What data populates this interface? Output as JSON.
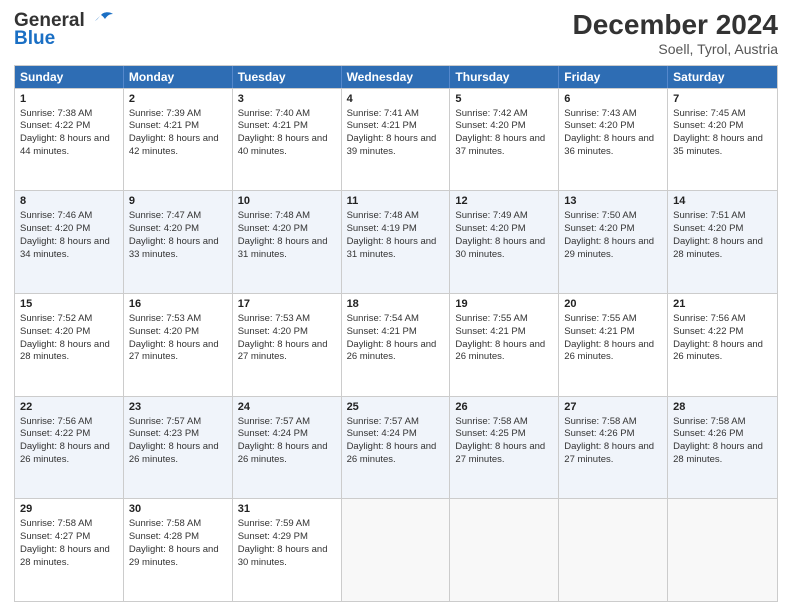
{
  "logo": {
    "line1": "General",
    "line2": "Blue"
  },
  "title": "December 2024",
  "subtitle": "Soell, Tyrol, Austria",
  "days": [
    "Sunday",
    "Monday",
    "Tuesday",
    "Wednesday",
    "Thursday",
    "Friday",
    "Saturday"
  ],
  "weeks": [
    [
      {
        "num": "1",
        "sr": "Sunrise: 7:38 AM",
        "ss": "Sunset: 4:22 PM",
        "dl": "Daylight: 8 hours and 44 minutes."
      },
      {
        "num": "2",
        "sr": "Sunrise: 7:39 AM",
        "ss": "Sunset: 4:21 PM",
        "dl": "Daylight: 8 hours and 42 minutes."
      },
      {
        "num": "3",
        "sr": "Sunrise: 7:40 AM",
        "ss": "Sunset: 4:21 PM",
        "dl": "Daylight: 8 hours and 40 minutes."
      },
      {
        "num": "4",
        "sr": "Sunrise: 7:41 AM",
        "ss": "Sunset: 4:21 PM",
        "dl": "Daylight: 8 hours and 39 minutes."
      },
      {
        "num": "5",
        "sr": "Sunrise: 7:42 AM",
        "ss": "Sunset: 4:20 PM",
        "dl": "Daylight: 8 hours and 37 minutes."
      },
      {
        "num": "6",
        "sr": "Sunrise: 7:43 AM",
        "ss": "Sunset: 4:20 PM",
        "dl": "Daylight: 8 hours and 36 minutes."
      },
      {
        "num": "7",
        "sr": "Sunrise: 7:45 AM",
        "ss": "Sunset: 4:20 PM",
        "dl": "Daylight: 8 hours and 35 minutes."
      }
    ],
    [
      {
        "num": "8",
        "sr": "Sunrise: 7:46 AM",
        "ss": "Sunset: 4:20 PM",
        "dl": "Daylight: 8 hours and 34 minutes."
      },
      {
        "num": "9",
        "sr": "Sunrise: 7:47 AM",
        "ss": "Sunset: 4:20 PM",
        "dl": "Daylight: 8 hours and 33 minutes."
      },
      {
        "num": "10",
        "sr": "Sunrise: 7:48 AM",
        "ss": "Sunset: 4:20 PM",
        "dl": "Daylight: 8 hours and 31 minutes."
      },
      {
        "num": "11",
        "sr": "Sunrise: 7:48 AM",
        "ss": "Sunset: 4:19 PM",
        "dl": "Daylight: 8 hours and 31 minutes."
      },
      {
        "num": "12",
        "sr": "Sunrise: 7:49 AM",
        "ss": "Sunset: 4:20 PM",
        "dl": "Daylight: 8 hours and 30 minutes."
      },
      {
        "num": "13",
        "sr": "Sunrise: 7:50 AM",
        "ss": "Sunset: 4:20 PM",
        "dl": "Daylight: 8 hours and 29 minutes."
      },
      {
        "num": "14",
        "sr": "Sunrise: 7:51 AM",
        "ss": "Sunset: 4:20 PM",
        "dl": "Daylight: 8 hours and 28 minutes."
      }
    ],
    [
      {
        "num": "15",
        "sr": "Sunrise: 7:52 AM",
        "ss": "Sunset: 4:20 PM",
        "dl": "Daylight: 8 hours and 28 minutes."
      },
      {
        "num": "16",
        "sr": "Sunrise: 7:53 AM",
        "ss": "Sunset: 4:20 PM",
        "dl": "Daylight: 8 hours and 27 minutes."
      },
      {
        "num": "17",
        "sr": "Sunrise: 7:53 AM",
        "ss": "Sunset: 4:20 PM",
        "dl": "Daylight: 8 hours and 27 minutes."
      },
      {
        "num": "18",
        "sr": "Sunrise: 7:54 AM",
        "ss": "Sunset: 4:21 PM",
        "dl": "Daylight: 8 hours and 26 minutes."
      },
      {
        "num": "19",
        "sr": "Sunrise: 7:55 AM",
        "ss": "Sunset: 4:21 PM",
        "dl": "Daylight: 8 hours and 26 minutes."
      },
      {
        "num": "20",
        "sr": "Sunrise: 7:55 AM",
        "ss": "Sunset: 4:21 PM",
        "dl": "Daylight: 8 hours and 26 minutes."
      },
      {
        "num": "21",
        "sr": "Sunrise: 7:56 AM",
        "ss": "Sunset: 4:22 PM",
        "dl": "Daylight: 8 hours and 26 minutes."
      }
    ],
    [
      {
        "num": "22",
        "sr": "Sunrise: 7:56 AM",
        "ss": "Sunset: 4:22 PM",
        "dl": "Daylight: 8 hours and 26 minutes."
      },
      {
        "num": "23",
        "sr": "Sunrise: 7:57 AM",
        "ss": "Sunset: 4:23 PM",
        "dl": "Daylight: 8 hours and 26 minutes."
      },
      {
        "num": "24",
        "sr": "Sunrise: 7:57 AM",
        "ss": "Sunset: 4:24 PM",
        "dl": "Daylight: 8 hours and 26 minutes."
      },
      {
        "num": "25",
        "sr": "Sunrise: 7:57 AM",
        "ss": "Sunset: 4:24 PM",
        "dl": "Daylight: 8 hours and 26 minutes."
      },
      {
        "num": "26",
        "sr": "Sunrise: 7:58 AM",
        "ss": "Sunset: 4:25 PM",
        "dl": "Daylight: 8 hours and 27 minutes."
      },
      {
        "num": "27",
        "sr": "Sunrise: 7:58 AM",
        "ss": "Sunset: 4:26 PM",
        "dl": "Daylight: 8 hours and 27 minutes."
      },
      {
        "num": "28",
        "sr": "Sunrise: 7:58 AM",
        "ss": "Sunset: 4:26 PM",
        "dl": "Daylight: 8 hours and 28 minutes."
      }
    ],
    [
      {
        "num": "29",
        "sr": "Sunrise: 7:58 AM",
        "ss": "Sunset: 4:27 PM",
        "dl": "Daylight: 8 hours and 28 minutes."
      },
      {
        "num": "30",
        "sr": "Sunrise: 7:58 AM",
        "ss": "Sunset: 4:28 PM",
        "dl": "Daylight: 8 hours and 29 minutes."
      },
      {
        "num": "31",
        "sr": "Sunrise: 7:59 AM",
        "ss": "Sunset: 4:29 PM",
        "dl": "Daylight: 8 hours and 30 minutes."
      },
      null,
      null,
      null,
      null
    ]
  ]
}
